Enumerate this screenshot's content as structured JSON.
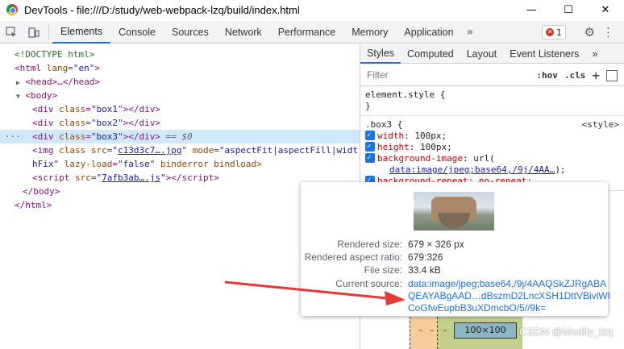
{
  "window": {
    "title": "DevTools - file:///D:/study/web-webpack-lzq/build/index.html",
    "minimize": "—",
    "maximize": "☐",
    "close": "✕"
  },
  "toolbar": {
    "tabs": [
      "Elements",
      "Console",
      "Sources",
      "Network",
      "Performance",
      "Memory",
      "Application"
    ],
    "more": "»",
    "error_count": "1",
    "settings_icon": "gear-icon",
    "menu_icon": "kebab-icon"
  },
  "elements": {
    "doctype": "<!DOCTYPE html>",
    "html_open": "<html",
    "html_lang_attr": " lang",
    "html_lang_val": "\"en\"",
    "head": "<head>…</head>",
    "body_open": "<body>",
    "divs": [
      {
        "cls": "\"box1\""
      },
      {
        "cls": "\"box2\""
      },
      {
        "cls": "\"box3\""
      }
    ],
    "selected_suffix": "== $0",
    "img_src": "c13d3c7….jpg",
    "img_mode": "\"aspectFit|aspectFill|widt",
    "img_line2_prefix": "hFix\"",
    "img_lazy": "\"false\"",
    "img_rest": "binderror bindload>",
    "script_src": "7afb3ab….js",
    "body_close": "</body>",
    "html_close": "</html>"
  },
  "styles_pane": {
    "tabs": [
      "Styles",
      "Computed",
      "Layout",
      "Event Listeners"
    ],
    "more": "»",
    "filter_placeholder": "Filter",
    "hov": ":hov",
    "cls": ".cls",
    "element_style": "element.style {",
    "close_brace": "}",
    "rule_selector": ".box3 {",
    "rule_origin": "<style>",
    "props": [
      {
        "name": "width",
        "value": "100px;"
      },
      {
        "name": "height",
        "value": "100px;"
      },
      {
        "name": "background-image",
        "value": "url("
      }
    ],
    "bg_url": "data:image/jpeg;base64,/9j/4AA…",
    "bg_url_end": ");",
    "partial_prop": "background-repeat: no-repeat;"
  },
  "popover": {
    "rows": [
      {
        "key": "Rendered size:",
        "value": "679 × 326 px"
      },
      {
        "key": "Rendered aspect ratio:",
        "value": "679:326"
      },
      {
        "key": "File size:",
        "value": "33.4 kB"
      }
    ],
    "source_key": "Current source:",
    "source_lines": [
      "data:image/jpeg;base64,/9j/4AAQSkZJRgABA",
      "QEAYABgAAD…dBszmD2LncXSH1DttVBiviWI",
      "CoGfwEupbB3uXDmcbO/5//9k="
    ]
  },
  "boxmodel": {
    "dash": "–",
    "content": "100×100"
  },
  "watermark": "CSDN @Modify_lzq"
}
